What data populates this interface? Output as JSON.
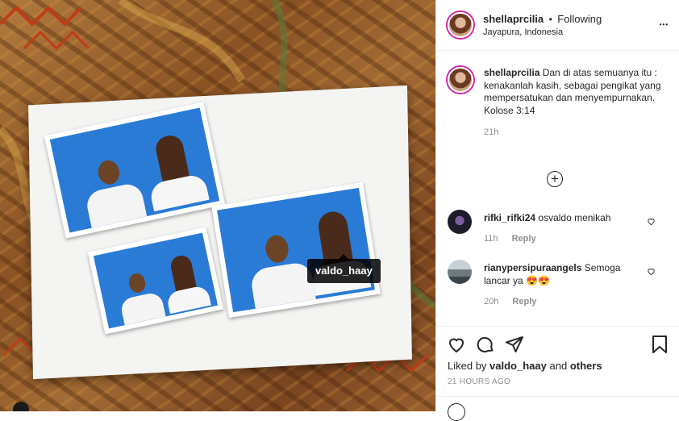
{
  "photo": {
    "tag": "valdo_haay"
  },
  "header": {
    "username": "shellaprcilia",
    "follow": "Following",
    "separator": "•",
    "location": "Jayapura, Indonesia",
    "more": "•••"
  },
  "caption": {
    "username": "shellaprcilia",
    "text": "Dan di atas semuanya itu : kenakanlah kasih, sebagai pengikat yang mempersatukan dan menyempurnakan.",
    "verse": "Kolose 3:14",
    "time": "21h"
  },
  "comments": [
    {
      "username": "rifki_rifki24",
      "text": "osvaldo menikah",
      "time": "11h",
      "reply": "Reply"
    },
    {
      "username": "rianypersipuraangels",
      "text": "Semoga lancar ya",
      "emoji": "😍😍",
      "time": "20h",
      "reply": "Reply"
    }
  ],
  "likes": {
    "prefix": "Liked by",
    "user": "valdo_haay",
    "connector": "and",
    "others": "others"
  },
  "posted": "21 HOURS AGO",
  "colors": {
    "tag_bg": "#000000",
    "text": "#262626",
    "muted": "#8e8e8e",
    "story_ring": "#d6249f",
    "photo_blue": "#2a7bd6"
  },
  "icons": [
    "heart-icon",
    "comment-icon",
    "share-icon",
    "save-icon",
    "add-comments-icon",
    "more-options-icon"
  ]
}
